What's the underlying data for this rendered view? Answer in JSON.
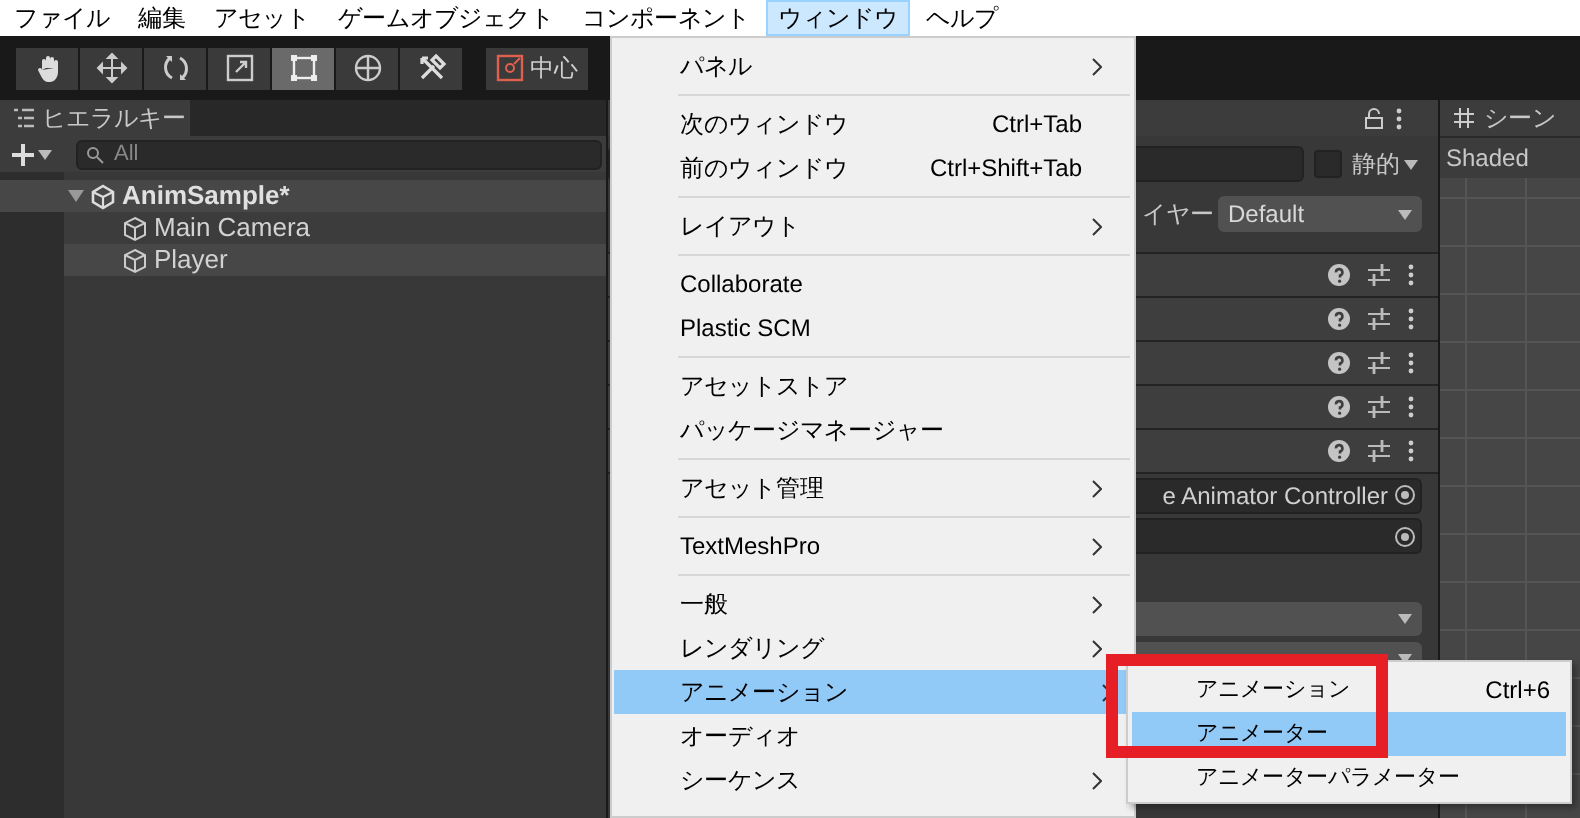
{
  "menu_bar": [
    {
      "label": "ファイル",
      "selected": false
    },
    {
      "label": "編集",
      "selected": false
    },
    {
      "label": "アセット",
      "selected": false
    },
    {
      "label": "ゲームオブジェクト",
      "selected": false
    },
    {
      "label": "コンポーネント",
      "selected": false
    },
    {
      "label": "ウィンドウ",
      "selected": true
    },
    {
      "label": "ヘルプ",
      "selected": false
    }
  ],
  "toolbar": {
    "tools": [
      {
        "kind": "hand",
        "selected": false
      },
      {
        "kind": "move",
        "selected": false
      },
      {
        "kind": "rotate",
        "selected": false
      },
      {
        "kind": "scale",
        "selected": false
      },
      {
        "kind": "rect",
        "selected": true
      },
      {
        "kind": "transform",
        "selected": false
      },
      {
        "kind": "custom",
        "selected": false
      }
    ],
    "pivot_button": "中心"
  },
  "hierarchy": {
    "tab": "ヒエラルキー",
    "search_placeholder": "All",
    "items": [
      {
        "label": "AnimSample*",
        "kind": "scene",
        "expanded": true,
        "children": [
          {
            "label": "Main Camera",
            "kind": "object"
          },
          {
            "label": "Player",
            "kind": "object"
          }
        ]
      }
    ]
  },
  "inspector": {
    "static_label": "静的",
    "static_checked": false,
    "layer_label": "イヤー",
    "layer_value": "Default",
    "controller_value": "e Animator Controller"
  },
  "scene": {
    "tab": "シーン",
    "shading": "Shaded"
  },
  "window_menu": {
    "groups": [
      [
        {
          "label": "パネル",
          "submenu": true,
          "selected": false
        }
      ],
      [
        {
          "label": "次のウィンドウ",
          "shortcut": "Ctrl+Tab",
          "submenu": false,
          "selected": false
        },
        {
          "label": "前のウィンドウ",
          "shortcut": "Ctrl+Shift+Tab",
          "submenu": false,
          "selected": false
        }
      ],
      [
        {
          "label": "レイアウト",
          "submenu": true,
          "selected": false
        }
      ],
      [
        {
          "label": "Collaborate",
          "submenu": false,
          "selected": false
        },
        {
          "label": "Plastic SCM",
          "submenu": false,
          "selected": false
        }
      ],
      [
        {
          "label": "アセットストア",
          "submenu": false,
          "selected": false
        },
        {
          "label": "パッケージマネージャー",
          "submenu": false,
          "selected": false
        }
      ],
      [
        {
          "label": "アセット管理",
          "submenu": true,
          "selected": false
        }
      ],
      [
        {
          "label": "TextMeshPro",
          "submenu": true,
          "selected": false
        }
      ],
      [
        {
          "label": "一般",
          "submenu": true,
          "selected": false
        },
        {
          "label": "レンダリング",
          "submenu": true,
          "selected": false
        },
        {
          "label": "アニメーション",
          "submenu": true,
          "selected": true
        },
        {
          "label": "オーディオ",
          "submenu": false,
          "selected": false
        },
        {
          "label": "シーケンス",
          "submenu": true,
          "selected": false
        }
      ]
    ]
  },
  "submenu": {
    "items": [
      {
        "label": "アニメーション",
        "shortcut": "Ctrl+6",
        "selected": false
      },
      {
        "label": "アニメーター",
        "selected": true
      },
      {
        "label": "アニメーターパラメーター",
        "selected": false
      }
    ]
  }
}
